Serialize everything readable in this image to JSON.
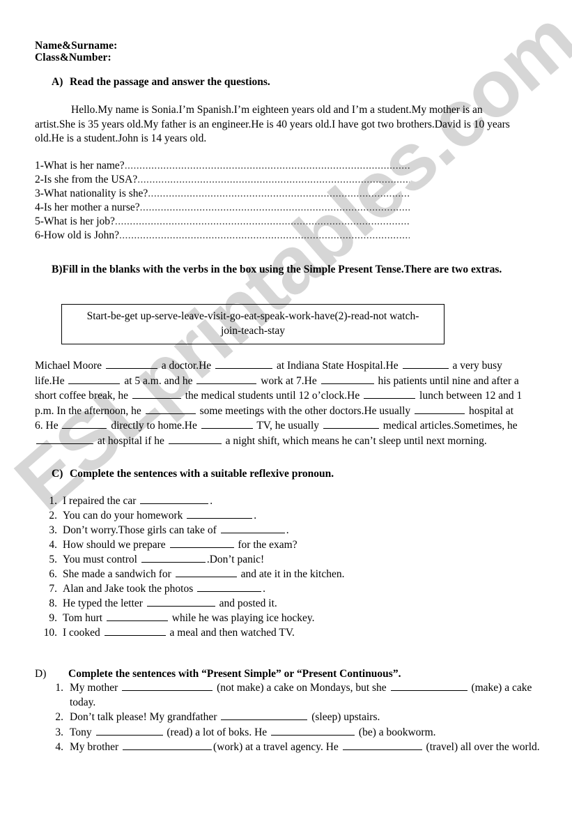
{
  "watermark": {
    "text": "ESLprintables.com",
    "color": "#d6d6d6"
  },
  "header": {
    "name_line": "Name&Surname:",
    "class_line": "Class&Number:"
  },
  "sections": {
    "a": {
      "marker": "A)",
      "title": "Read the passage and answer the questions.",
      "passage": "Hello.My name is Sonia.I’m Spanish.I’m eighteen years old and I’m a student.My mother is an artist.She is 35 years old.My father is an engineer.He is 40 years old.I have got two brothers.David is 10 years old.He is a student.John is 14 years old.",
      "questions": [
        "1-What is her name?",
        "2-Is she from the USA?",
        "3-What nationality is she?",
        "4-Is her mother a nurse?",
        "5-What is her job?",
        "6-How old is John?"
      ],
      "dots": "........................................................................................................................................................"
    },
    "b": {
      "marker": "B)",
      "title": "Fill in the blanks with the verbs in the box using the Simple Present Tense.There are two extras.",
      "wordbank_line1": "Start-be-get up-serve-leave-visit-go-eat-speak-work-have(2)-read-not watch-",
      "wordbank_line2": "join-teach-stay",
      "paragraph_parts": [
        "Michael Moore ",
        " a doctor.He ",
        " at Indiana State Hospital.He ",
        " a very busy life.He ",
        " at 5 a.m. and he ",
        " work at 7.He ",
        " his patients until nine and after a short coffee break, he ",
        " the medical students until 12 o’clock.He ",
        " lunch between 12 and 1 p.m. In the afternoon, he ",
        " some meetings with the other doctors.He usually ",
        " hospital at 6. He ",
        " directly to home.He ",
        " TV, he usually ",
        " medical articles.Sometimes, he ",
        " at hospital if he ",
        " a night shift, which means he can’t sleep until next morning."
      ]
    },
    "c": {
      "marker": "C)",
      "title": "Complete the sentences with a suitable reflexive pronoun.",
      "items": [
        {
          "num": "1.",
          "before": "I repaired the car ",
          "after": "."
        },
        {
          "num": "2.",
          "before": "You can do your homework ",
          "after": "."
        },
        {
          "num": "3.",
          "before": "Don’t worry.Those girls can take of ",
          "after": "."
        },
        {
          "num": "4.",
          "before": "How should we prepare ",
          "after": " for the exam?"
        },
        {
          "num": "5.",
          "before": "You must control ",
          "after": ".Don’t panic!"
        },
        {
          "num": "6.",
          "before": "She made a sandwich for ",
          "after": " and ate it in the kitchen."
        },
        {
          "num": "7.",
          "before": "Alan and Jake took the photos ",
          "after": "."
        },
        {
          "num": "8.",
          "before": "He typed the letter ",
          "after": " and posted it."
        },
        {
          "num": "9.",
          "before": "Tom hurt ",
          "after": " while he was playing ice hockey."
        },
        {
          "num": "10.",
          "before": "I cooked ",
          "after": " a meal and then watched TV."
        }
      ]
    },
    "d": {
      "marker": "D)",
      "title": "Complete the sentences with “Present Simple” or “Present Continuous”.",
      "items": [
        {
          "num": "1.",
          "p1": "My mother ",
          "p2": " (not make) a cake on Mondays, but she ",
          "p3": " (make) a cake today."
        },
        {
          "num": "2.",
          "p1": "Don’t talk please! My grandfather ",
          "p2": " (sleep) upstairs.",
          "p3": ""
        },
        {
          "num": "3.",
          "p1": "Tony ",
          "p2": " (read) a lot of boks. He ",
          "p3": " (be) a bookworm."
        },
        {
          "num": "4.",
          "p1": "My brother ",
          "p2": "(work) at a travel agency. He ",
          "p3": " (travel) all over the world."
        }
      ]
    }
  }
}
